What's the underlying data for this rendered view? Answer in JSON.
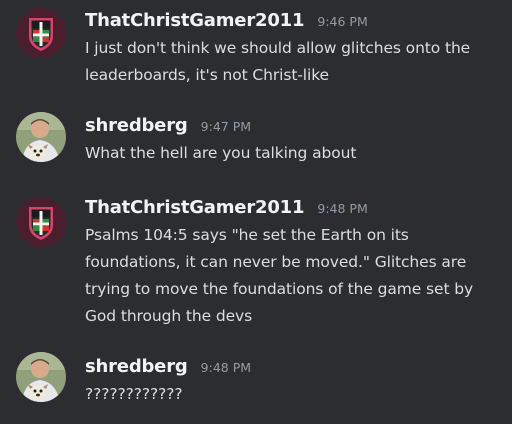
{
  "messages": [
    {
      "username": "ThatChristGamer2011",
      "timestamp": "9:46 PM",
      "avatar_icon": "heraldic-shield-crest-icon",
      "text": "I just don't think we should allow glitches onto the leaderboards, it's not Christ-like"
    },
    {
      "username": "shredberg",
      "timestamp": "9:47 PM",
      "avatar_icon": "user-photo-icon",
      "text": "What the hell are you talking about"
    },
    {
      "username": "ThatChristGamer2011",
      "timestamp": "9:48 PM",
      "avatar_icon": "heraldic-shield-crest-icon",
      "text": "Psalms 104:5 says \"he set the Earth on its foundations, it can never be moved.\" Glitches are trying to move the foundations of the game set by God through the devs"
    },
    {
      "username": "shredberg",
      "timestamp": "9:48 PM",
      "avatar_icon": "user-photo-icon",
      "text": "????????????"
    }
  ],
  "colors": {
    "background": "#2b2d31",
    "username": "#f2f3f5",
    "timestamp": "#949ba4",
    "text": "#dbdee1",
    "crest_border": "#d5446f",
    "crest_field": "#4b1e2e"
  }
}
